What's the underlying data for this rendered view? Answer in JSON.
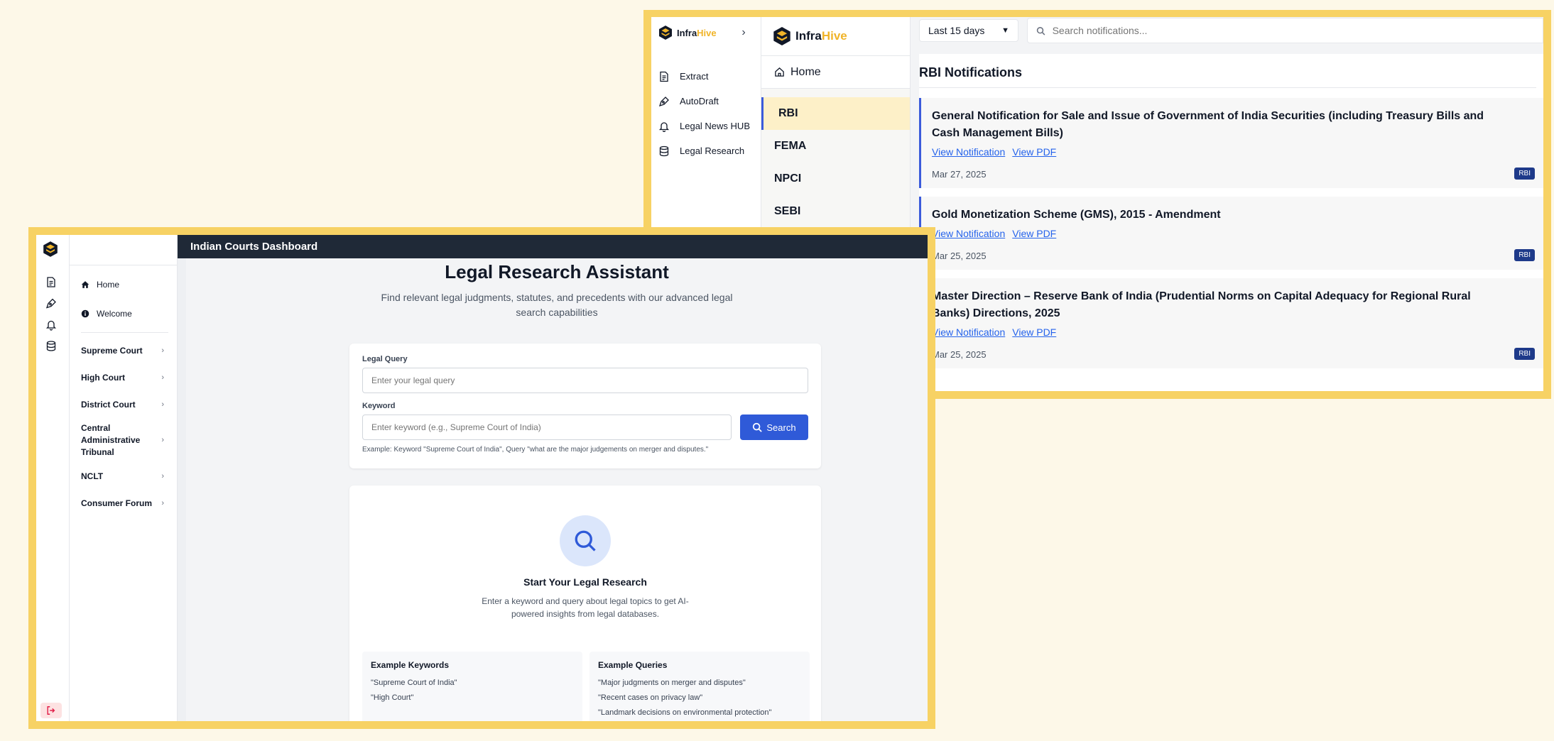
{
  "colors": {
    "frame": "#f7d264",
    "accent_blue": "#2f5ad8",
    "header_dark": "#1f2937",
    "badge_navy": "#1e3a8a",
    "brand_gold": "#f0b429"
  },
  "rbi_window": {
    "brand": {
      "infra": "Infra",
      "hive": "Hive"
    },
    "sidebar_nav": [
      {
        "label": "Extract",
        "icon": "document-icon"
      },
      {
        "label": "AutoDraft",
        "icon": "pen-icon"
      },
      {
        "label": "Legal News HUB",
        "icon": "bell-icon"
      },
      {
        "label": "Legal Research",
        "icon": "database-icon"
      }
    ],
    "home_label": "Home",
    "categories": [
      "RBI",
      "FEMA",
      "NPCI",
      "SEBI"
    ],
    "active_category": "RBI",
    "date_filter": "Last 15 days",
    "search_placeholder": "Search notifications...",
    "heading": "RBI Notifications",
    "notifications": [
      {
        "title": "General Notification for Sale and Issue of Government of India Securities (including Treasury Bills and Cash Management Bills)",
        "view_label": "View Notification",
        "pdf_label": "View PDF",
        "date": "Mar 27, 2025",
        "badge": "RBI"
      },
      {
        "title": "Gold Monetization Scheme (GMS), 2015 - Amendment",
        "view_label": "View Notification",
        "pdf_label": "View PDF",
        "date": "Mar 25, 2025",
        "badge": "RBI"
      },
      {
        "title": "Master Direction – Reserve Bank of India (Prudential Norms on Capital Adequacy for Regional Rural Banks) Directions, 2025",
        "view_label": "View Notification",
        "pdf_label": "View PDF",
        "date": "Mar 25, 2025",
        "badge": "RBI"
      }
    ]
  },
  "courts_window": {
    "header_title": "Indian Courts Dashboard",
    "side_top": [
      {
        "label": "Home",
        "icon": "home-icon"
      },
      {
        "label": "Welcome",
        "icon": "info-icon"
      }
    ],
    "courts": [
      "Supreme Court",
      "High Court",
      "District Court",
      "Central Administrative Tribunal",
      "NCLT",
      "Consumer Forum"
    ],
    "title": "Legal Research Assistant",
    "subtitle": "Find relevant legal judgments, statutes, and precedents with our advanced legal search capabilities",
    "form": {
      "query_label": "Legal Query",
      "query_placeholder": "Enter your legal query",
      "keyword_label": "Keyword",
      "keyword_placeholder": "Enter keyword (e.g., Supreme Court of India)",
      "search_button": "Search",
      "example_text": "Example: Keyword \"Supreme Court of India\", Query \"what are the major judgements on merger and disputes.\""
    },
    "empty_state": {
      "title": "Start Your Legal Research",
      "description": "Enter a keyword and query about legal topics to get AI-powered insights from legal databases."
    },
    "example_keywords": {
      "title": "Example Keywords",
      "items": [
        "\"Supreme Court of India\"",
        "\"High Court\""
      ]
    },
    "example_queries": {
      "title": "Example Queries",
      "items": [
        "\"Major judgments on merger and disputes\"",
        "\"Recent cases on privacy law\"",
        "\"Landmark decisions on environmental protection\""
      ]
    }
  }
}
